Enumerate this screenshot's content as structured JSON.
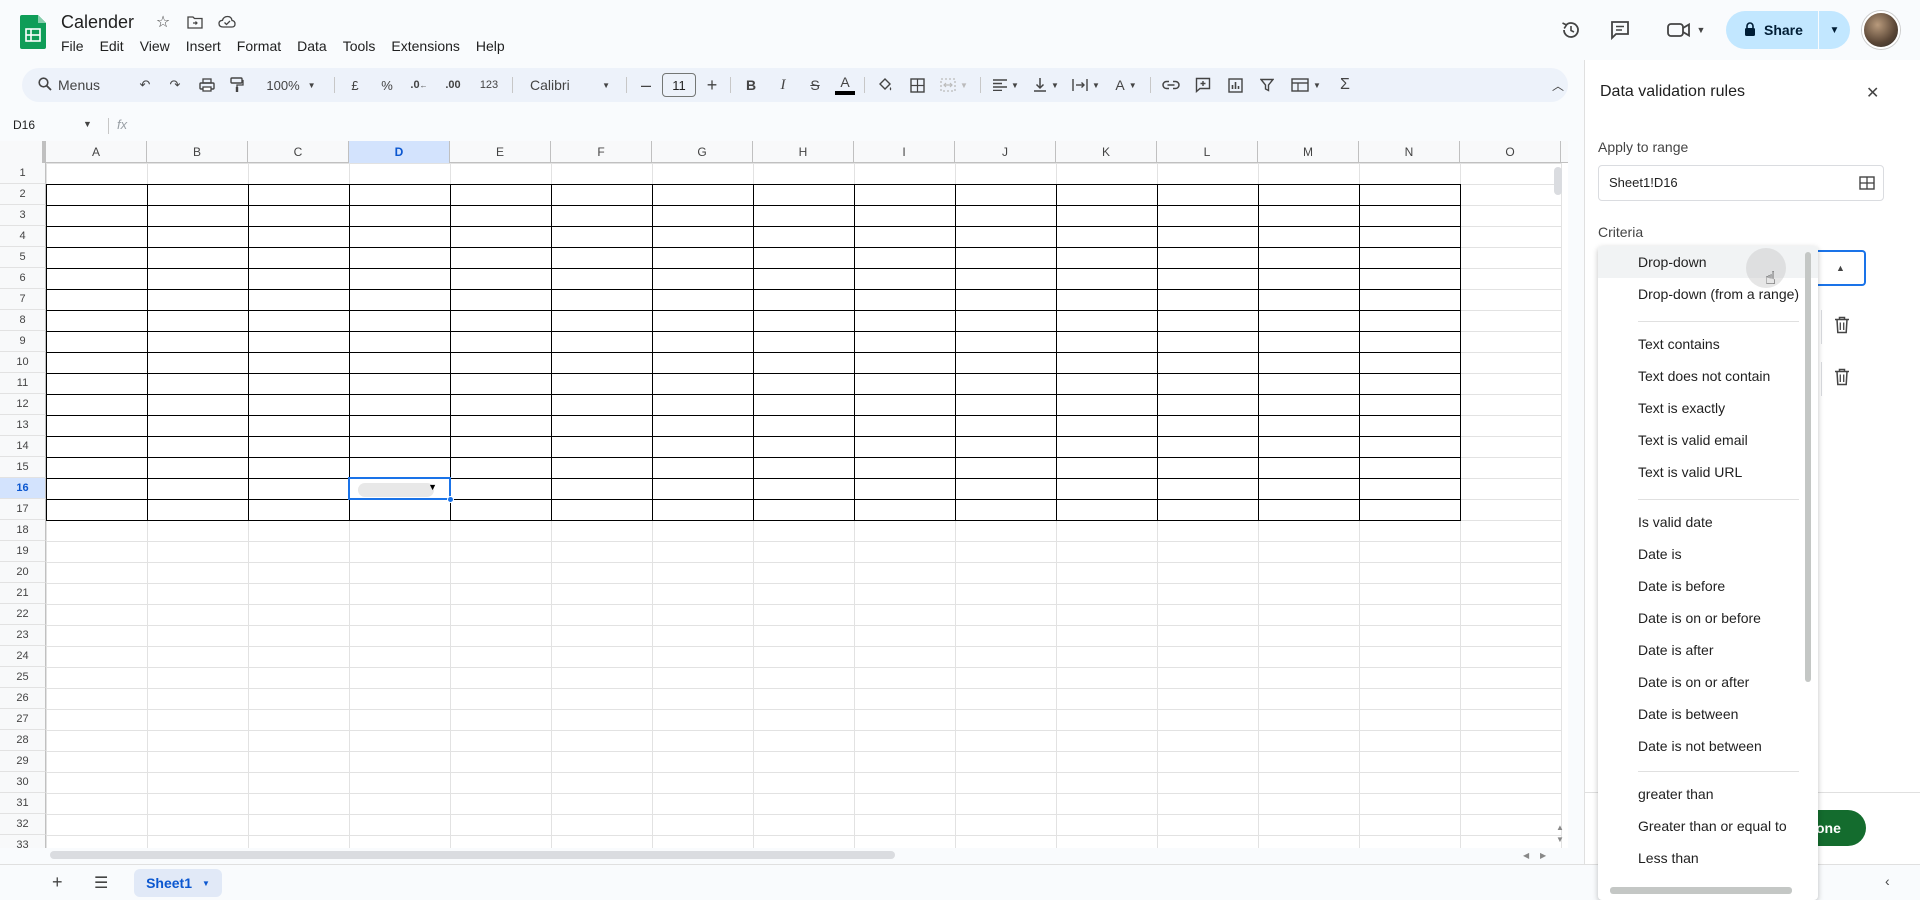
{
  "doc": {
    "title": "Calender"
  },
  "menu": [
    "File",
    "Edit",
    "View",
    "Insert",
    "Format",
    "Data",
    "Tools",
    "Extensions",
    "Help"
  ],
  "share": {
    "label": "Share"
  },
  "toolbar": {
    "search_label": "Menus",
    "zoom": "100%",
    "currency": "£",
    "percent": "%",
    "dec_decrease": ".0",
    "dec_increase": ".00",
    "number_format": "123",
    "font": "Calibri",
    "font_size": "11"
  },
  "formula": {
    "namebox": "D16",
    "fx": "fx"
  },
  "grid": {
    "columns": [
      "A",
      "B",
      "C",
      "D",
      "E",
      "F",
      "G",
      "H",
      "I",
      "J",
      "K",
      "L",
      "M",
      "N",
      "O"
    ],
    "rows": [
      "1",
      "2",
      "3",
      "4",
      "5",
      "6",
      "7",
      "8",
      "9",
      "10",
      "11",
      "12",
      "13",
      "14",
      "15",
      "16",
      "17",
      "18",
      "19",
      "20",
      "21",
      "22",
      "23",
      "24",
      "25",
      "26",
      "27",
      "28",
      "29",
      "30",
      "31",
      "32",
      "33"
    ],
    "selected_column": "D",
    "selected_row": "16"
  },
  "sheet": {
    "tab": "Sheet1"
  },
  "panel": {
    "title": "Data validation rules",
    "apply_label": "Apply to range",
    "range_value": "Sheet1!D16",
    "criteria_label": "Criteria",
    "done_label": "one"
  },
  "dropdown": {
    "items": [
      "Drop-down",
      "Drop-down (from a range)",
      "Text contains",
      "Text does not contain",
      "Text is exactly",
      "Text is valid email",
      "Text is valid URL",
      "Is valid date",
      "Date is",
      "Date is before",
      "Date is on or before",
      "Date is after",
      "Date is on or after",
      "Date is between",
      "Date is not between",
      "greater than",
      "Greater than or equal to",
      "Less than"
    ]
  },
  "colors": {
    "accent": "#1a73e8",
    "share_bg": "#c2e7ff",
    "done_bg": "#146c2e",
    "sheets_green": "#0f9d58"
  }
}
